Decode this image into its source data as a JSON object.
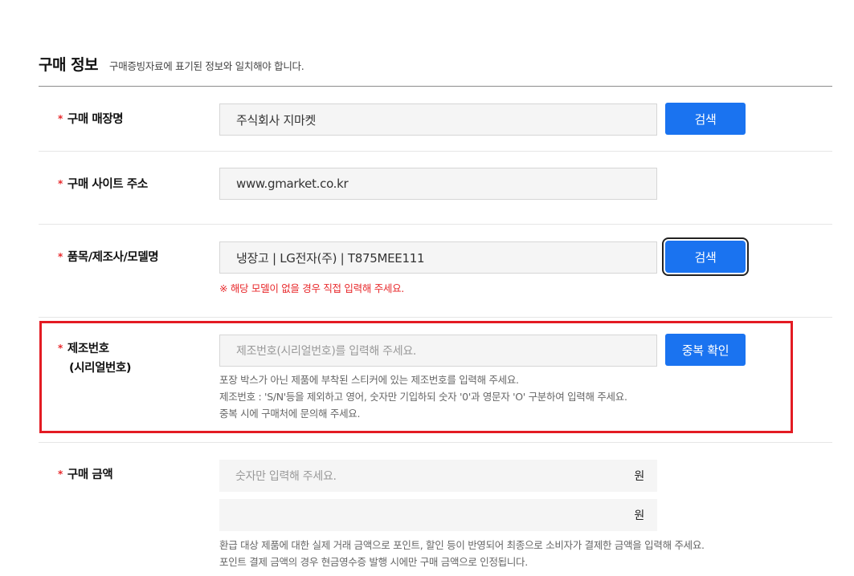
{
  "section": {
    "title": "구매 정보",
    "description": "구매증빙자료에 표기된 정보와 일치해야 합니다."
  },
  "required_mark": "*",
  "store": {
    "label": "구매 매장명",
    "value": "주식회사 지마켓",
    "button": "검색"
  },
  "site": {
    "label": "구매 사이트 주소",
    "value": "www.gmarket.co.kr"
  },
  "product": {
    "label": "품목/제조사/모델명",
    "value": "냉장고 | LG전자(주) | T875MEE111",
    "button": "검색",
    "warning": "※ 해당 모델이 없을 경우 직접 입력해 주세요."
  },
  "serial": {
    "label_line1": "제조번호",
    "label_line2": "(시리얼번호)",
    "placeholder": "제조번호(시리얼번호)를 입력해 주세요.",
    "button": "중복 확인",
    "help": [
      "포장 박스가 아닌 제품에 부착된 스티커에 있는 제조번호를 입력해 주세요.",
      "제조번호 : 'S/N'등을 제외하고 영어, 숫자만 기입하되 숫자 '0'과 영문자 'O' 구분하여 입력해 주세요.",
      "중복 시에 구매처에 문의해 주세요."
    ]
  },
  "amount": {
    "label": "구매 금액",
    "placeholder": "숫자만 입력해 주세요.",
    "unit": "원",
    "second_value": "",
    "help": [
      "환급 대상 제품에 대한 실제 거래 금액으로 포인트, 할인 등이 반영되어 최종으로 소비자가 결제한 금액을 입력해 주세요.",
      "포인트 결제 금액의 경우 현금영수증 발행 시에만 구매 금액으로 인정됩니다."
    ]
  },
  "colors": {
    "accent": "#1a73f0",
    "required": "#e8282b",
    "highlight": "#e31b23"
  }
}
